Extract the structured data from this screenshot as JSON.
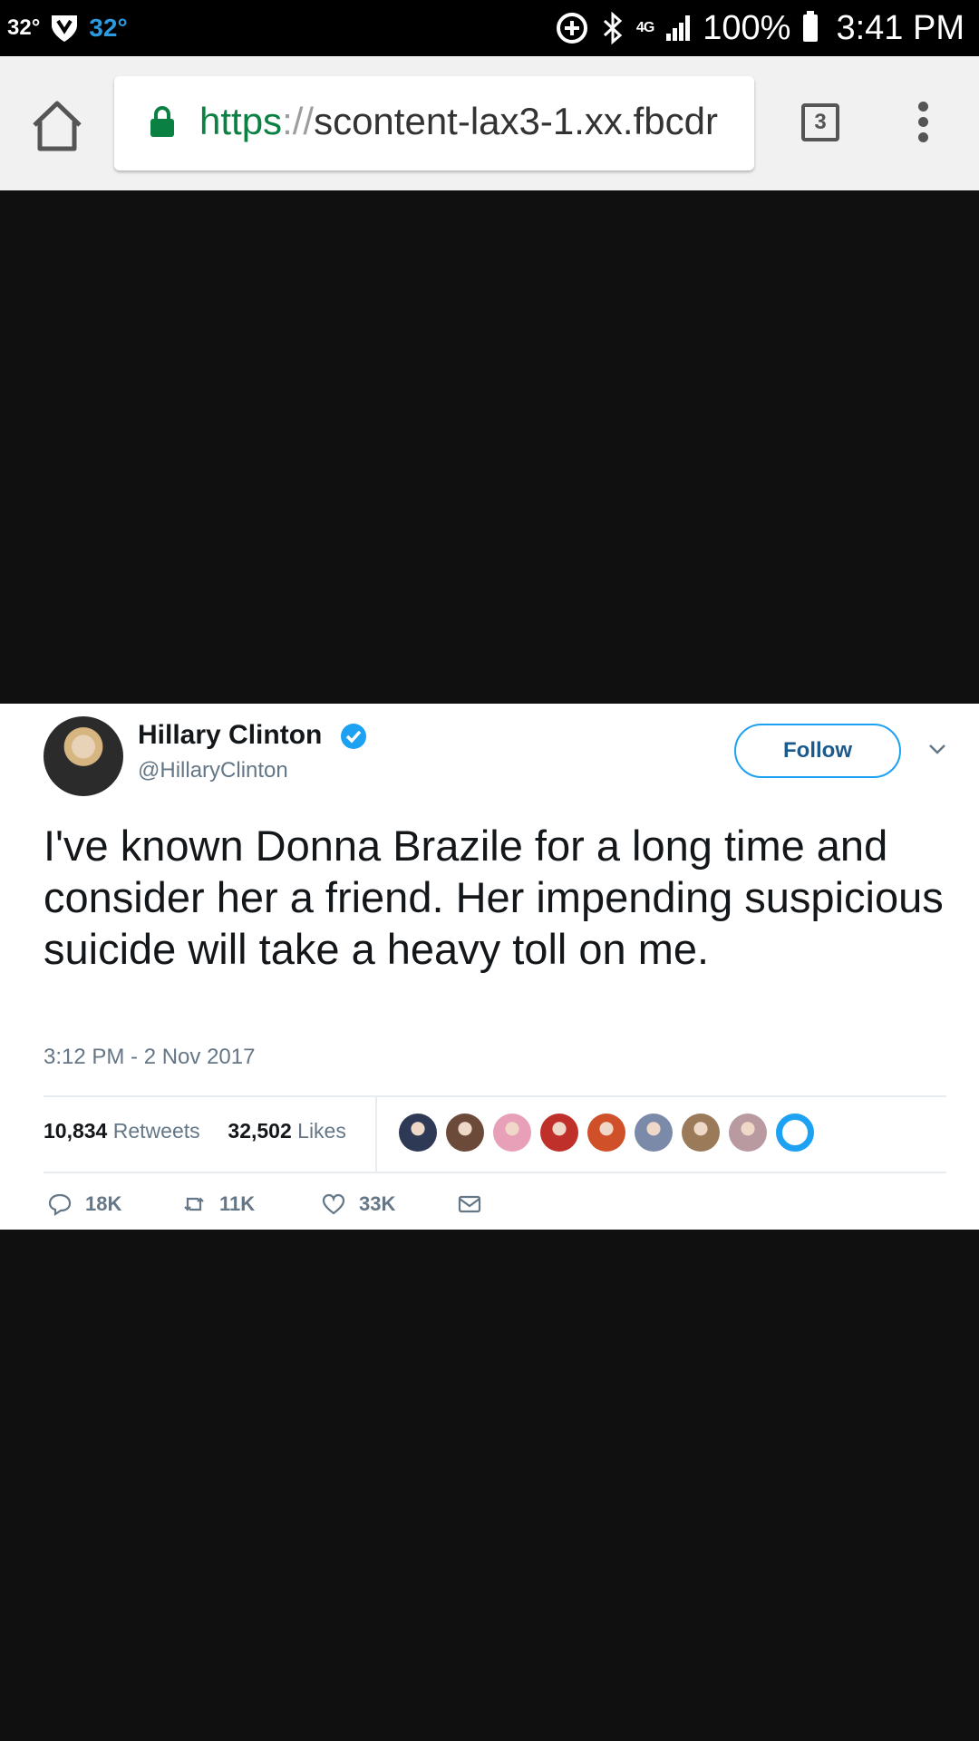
{
  "status_bar": {
    "temp_small": "32°",
    "temp_colored": "32°",
    "network": "4G",
    "battery": "100%",
    "time": "3:41 PM"
  },
  "browser": {
    "url_scheme": "https",
    "url_sep": "://",
    "url_host": "scontent-lax3-1.xx.fbcdr",
    "tab_count": "3"
  },
  "tweet": {
    "name": "Hillary Clinton",
    "handle": "@HillaryClinton",
    "follow_label": "Follow",
    "text": "I've known Donna Brazile for a long time and consider her a friend. Her impending suspicious suicide will take a heavy toll on me.",
    "timestamp": "3:12 PM - 2 Nov 2017",
    "retweets_count": "10,834",
    "retweets_label": "Retweets",
    "likes_count": "32,502",
    "likes_label": "Likes",
    "liker_colors": [
      "#2e3a55",
      "#6b4a3a",
      "#e8a0b8",
      "#c0302a",
      "#d0502a",
      "#7a8aa8",
      "#9a7a58",
      "#b89aa0",
      "#1da1f2"
    ],
    "reply_count": "18K",
    "retweet_count_short": "11K",
    "like_count_short": "33K"
  },
  "colors": {
    "secure_green": "#0b8043",
    "twitter_blue": "#1da1f2"
  }
}
